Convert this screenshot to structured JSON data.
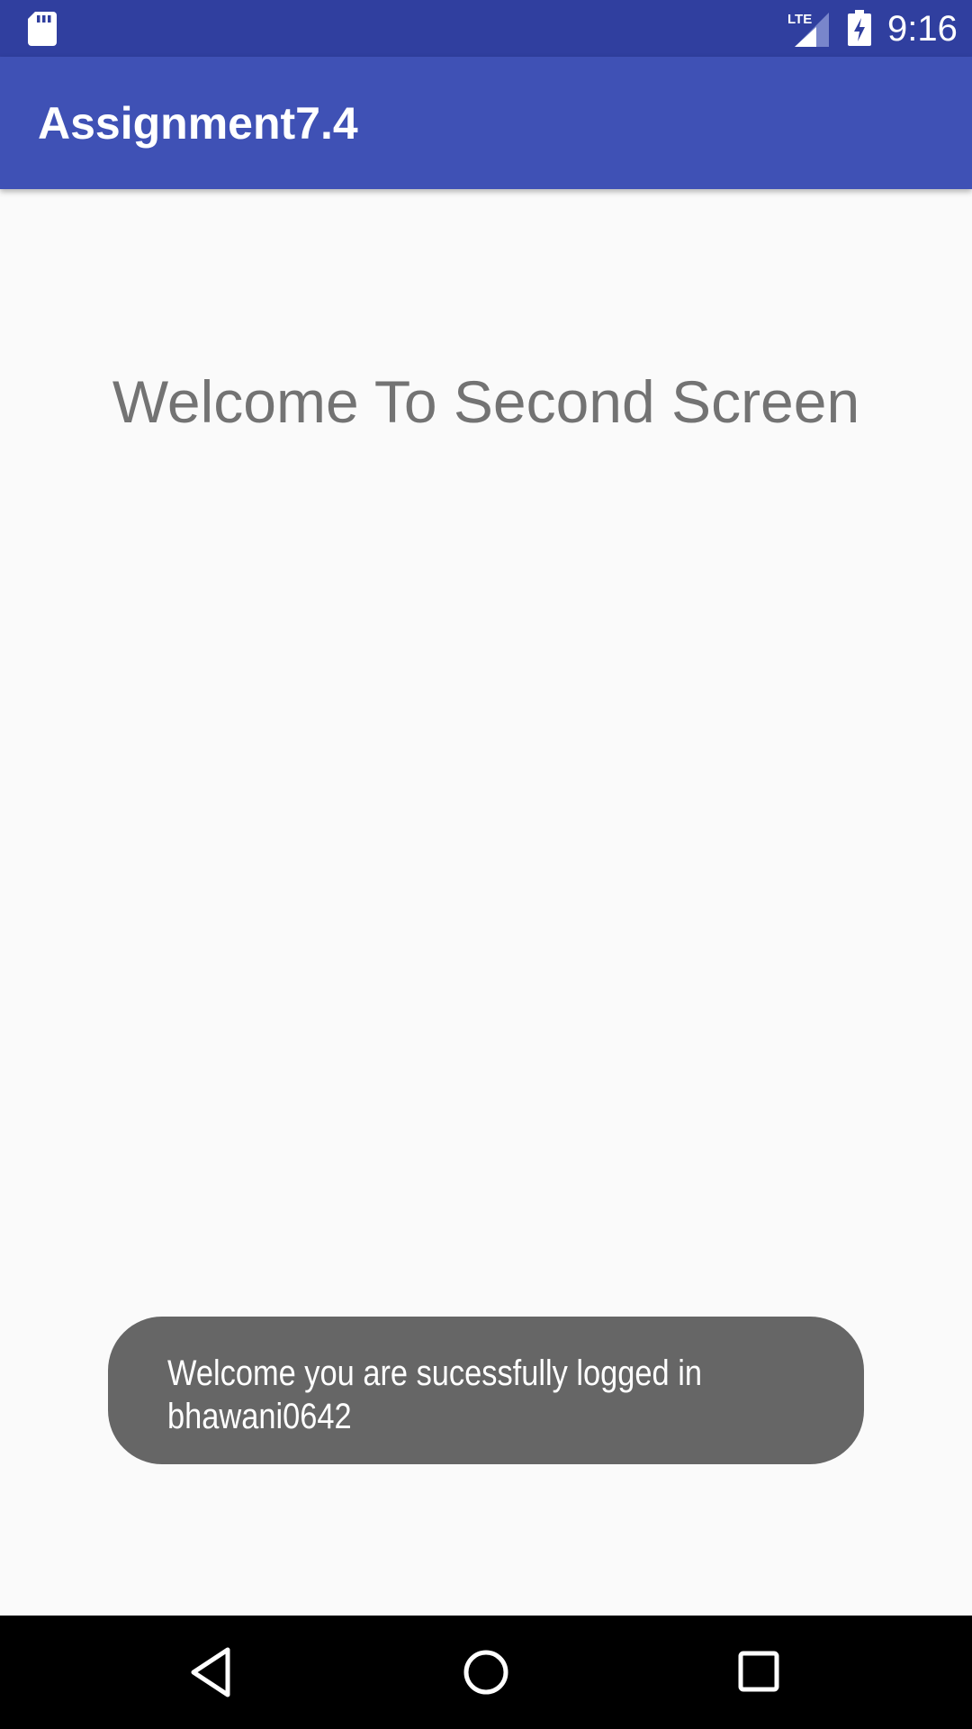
{
  "status_bar": {
    "time": "9:16",
    "network_label": "LTE",
    "icons": [
      "sd-card-icon",
      "lte-signal-icon",
      "battery-charging-icon"
    ]
  },
  "app_bar": {
    "title": "Assignment7.4",
    "color": "#3f51b5"
  },
  "main": {
    "heading": "Welcome To Second Screen"
  },
  "toast": {
    "line1": "Welcome you are sucessfully logged in",
    "line2": "bhawani0642"
  },
  "nav_bar": {
    "icons": [
      "back-icon",
      "home-icon",
      "recents-icon"
    ]
  },
  "colors": {
    "status_bar": "#303f9f",
    "app_bar": "#3f51b5",
    "background": "#fafafa",
    "heading_text": "#737373",
    "toast_background": "#666666",
    "nav_bar": "#000000"
  }
}
